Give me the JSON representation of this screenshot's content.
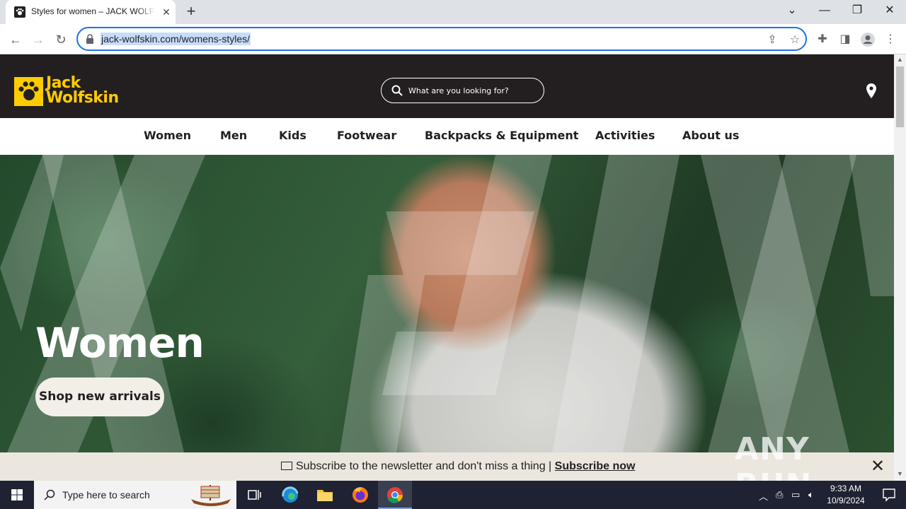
{
  "browser": {
    "tab_title": "Styles for women – JACK WOLFSKIN",
    "url": "jack-wolfskin.com/womens-styles/"
  },
  "site": {
    "logo_line1": "Jack",
    "logo_line2": "Wolfskin",
    "search_placeholder": "What are you looking for?",
    "nav": [
      "Women",
      "Men",
      "Kids",
      "Footwear",
      "Backpacks & Equipment",
      "Activities",
      "About us"
    ],
    "hero_title": "Women",
    "hero_cta": "Shop new arrivals",
    "newsletter_text": "Subscribe to the newsletter and don't miss a thing | ",
    "newsletter_link": "Subscribe now",
    "brand_color": "#ffcc00"
  },
  "watermark": "ANY RUN",
  "taskbar": {
    "search_text": "Type here to search",
    "time": "9:33 AM",
    "date": "10/9/2024"
  }
}
